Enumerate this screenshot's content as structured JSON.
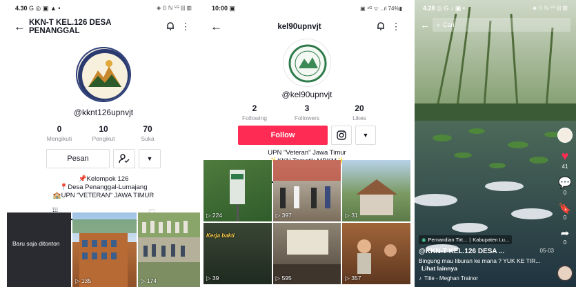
{
  "panel1": {
    "status": {
      "time": "4.30",
      "indicators": "G ◎ ▣ ▲ •",
      "right": "◈ ⏲ ℕ ⁵ᴳ ||| ▥"
    },
    "topbar": {
      "title": "KKN-T KEL.126 DESA PENANGGAL"
    },
    "username": "@kknt126upnvjt",
    "stats": [
      {
        "n": "0",
        "l": "Mengikuti"
      },
      {
        "n": "10",
        "l": "Pengikut"
      },
      {
        "n": "70",
        "l": "Suka"
      }
    ],
    "message_label": "Pesan",
    "bio": [
      "📌Kelompok 126",
      "📍Desa Penanggal-Lumajang",
      "🏫UPN \"VETERAN\" JAWA TIMUR"
    ],
    "recent_label": "Baru saja ditonton",
    "videos": [
      {
        "views": "135"
      },
      {
        "views": "174"
      }
    ]
  },
  "panel2": {
    "status": {
      "time": "10:00",
      "right": "▣ ⁴ᴳ ᯤ ‥ıl 74%▮"
    },
    "topbar": {
      "title": "kel90upnvjt"
    },
    "username": "@kel90upnvjt",
    "stats": [
      {
        "n": "2",
        "l": "Following"
      },
      {
        "n": "3",
        "l": "Followers"
      },
      {
        "n": "20",
        "l": "Likes"
      }
    ],
    "follow_label": "Follow",
    "bio": [
      "UPN \"Veteran\" Jawa Timur",
      "✨KKN Tematik MBKM✨"
    ],
    "videos": [
      {
        "views": "224",
        "badge": "",
        "overlay": "",
        "bg": "#3f6a3a"
      },
      {
        "views": "397",
        "badge": "",
        "overlay": "",
        "bg": "#8a7b6a"
      },
      {
        "views": "31",
        "badge": "",
        "overlay": "",
        "bg": "#6f8a5c"
      },
      {
        "views": "39",
        "badge": "",
        "overlay": "Kerja bakti",
        "bg": "#2f3a2e"
      },
      {
        "views": "595",
        "badge": "",
        "overlay": "",
        "bg": "#5b4f43"
      },
      {
        "views": "357",
        "badge": "",
        "overlay": "",
        "bg": "#7a4a2e"
      }
    ]
  },
  "panel3": {
    "status": {
      "time": "4.28",
      "right": "◈ ⏲ ℕ ⁵ᴳ ||| ▥"
    },
    "search_placeholder": "Cari",
    "location": "Pemandian Tirt...",
    "location_region": "Kabupaten Lu...",
    "author": "@KKN-T KEL.126 DESA ...",
    "date": "05-03",
    "caption": "Bingung mau liburan ke mana ? YUK KE TIR...",
    "see_more": "Lihat lainnya",
    "music": "Title - Meghan Trainor",
    "likes": "41",
    "comments": "0",
    "saves": "0",
    "shares": "0"
  },
  "colors": {
    "accent": "#fe2c55",
    "text": "#161823",
    "muted": "#8a8b91"
  }
}
